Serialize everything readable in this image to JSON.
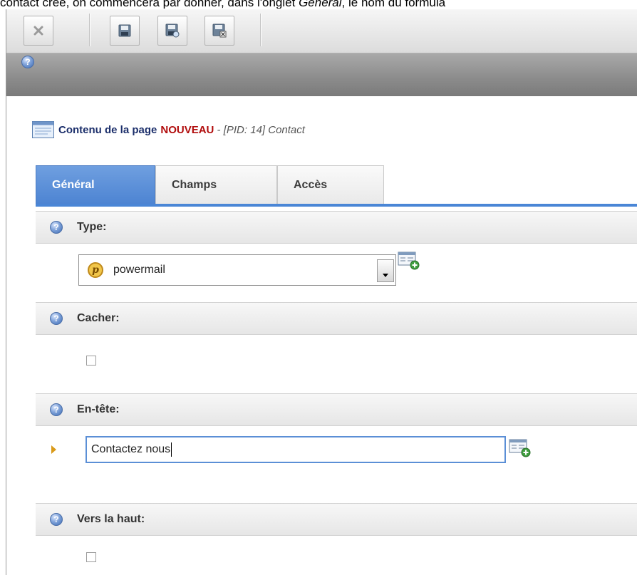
{
  "caption": {
    "text_before": "contact créé, on commencera par donner, dans l'onglet ",
    "text_italic": "Général",
    "text_after": ", le nom du formula"
  },
  "toolbar": {
    "buttons": [
      {
        "name": "close",
        "icon": "close-icon"
      },
      {
        "name": "save",
        "icon": "save-icon"
      },
      {
        "name": "save-view",
        "icon": "save-view-icon"
      },
      {
        "name": "save-close",
        "icon": "save-close-icon"
      }
    ]
  },
  "page": {
    "title_prefix": "Contenu de la page",
    "title_highlight": "NOUVEAU",
    "separator": " - ",
    "meta": "[PID: 14] Contact"
  },
  "tabs": [
    {
      "label": "Général",
      "active": true
    },
    {
      "label": "Champs",
      "active": false
    },
    {
      "label": "Accès",
      "active": false
    }
  ],
  "fields": {
    "type": {
      "label": "Type:",
      "value": "powermail"
    },
    "hide": {
      "label": "Cacher:",
      "checked": false
    },
    "header": {
      "label": "En-tête:",
      "value": "Contactez nous"
    },
    "to_top": {
      "label": "Vers la haut:",
      "checked": false
    }
  },
  "colors": {
    "accent": "#4a86d6",
    "title_highlight": "#b10c0c",
    "title": "#1c2f6b"
  }
}
